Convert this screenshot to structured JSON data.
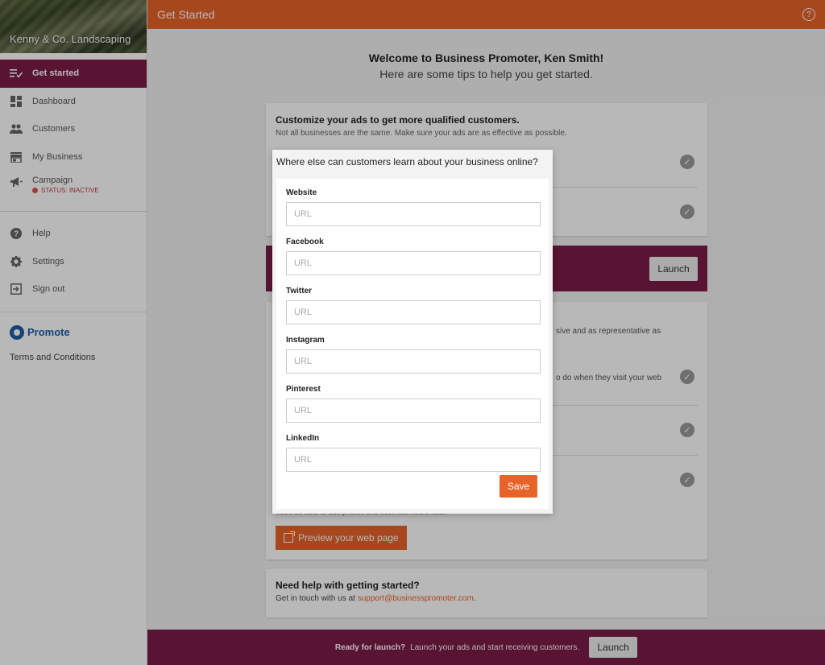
{
  "sidebar": {
    "brand_name": "Kenny & Co. Landscaping",
    "items": [
      {
        "label": "Get started",
        "icon": "checklist-icon"
      },
      {
        "label": "Dashboard",
        "icon": "dashboard-icon"
      },
      {
        "label": "Customers",
        "icon": "people-icon"
      },
      {
        "label": "My Business",
        "icon": "store-icon"
      },
      {
        "label": "Campaign",
        "icon": "megaphone-icon",
        "status": "STATUS: INACTIVE"
      },
      {
        "label": "Help",
        "icon": "help-icon"
      },
      {
        "label": "Settings",
        "icon": "gear-icon"
      },
      {
        "label": "Sign out",
        "icon": "sign-out-icon"
      }
    ],
    "promote_label": "Promote",
    "terms": "Terms and Conditions"
  },
  "header": {
    "title": "Get Started",
    "help_glyph": "?"
  },
  "welcome": {
    "title": "Welcome to Business Promoter, Ken Smith!",
    "subtitle": "Here are some tips to help you get started."
  },
  "card1": {
    "title": "Customize your ads to get more qualified customers.",
    "subtitle": "Not all businesses are the same. Make sure your ads are as effective as possible."
  },
  "launch_mid": {
    "label": "Launch"
  },
  "card3": {
    "text1": "sive and as representative as",
    "text2": "o do when they visit your web",
    "hint": "You'll be able to add photos and business hours later.",
    "preview_label": "Preview your web page"
  },
  "card4": {
    "title": "Need help with getting started?",
    "text_prefix": "Get in touch with us at ",
    "email": "support@businesspromoter.com",
    "text_suffix": "."
  },
  "footer": {
    "bold": "Ready for launch?",
    "text": "Launch your ads and start receiving customers.",
    "button": "Launch"
  },
  "modal": {
    "title": "Where else can customers learn about your business online?",
    "fields": [
      {
        "label": "Website",
        "placeholder": "URL"
      },
      {
        "label": "Facebook",
        "placeholder": "URL"
      },
      {
        "label": "Twitter",
        "placeholder": "URL"
      },
      {
        "label": "Instagram",
        "placeholder": "URL"
      },
      {
        "label": "Pinterest",
        "placeholder": "URL"
      },
      {
        "label": "LinkedIn",
        "placeholder": "URL"
      }
    ],
    "save_label": "Save"
  },
  "colors": {
    "accent": "#e8632a",
    "brand": "#7c1d47",
    "status_inactive": "#d9534f"
  }
}
